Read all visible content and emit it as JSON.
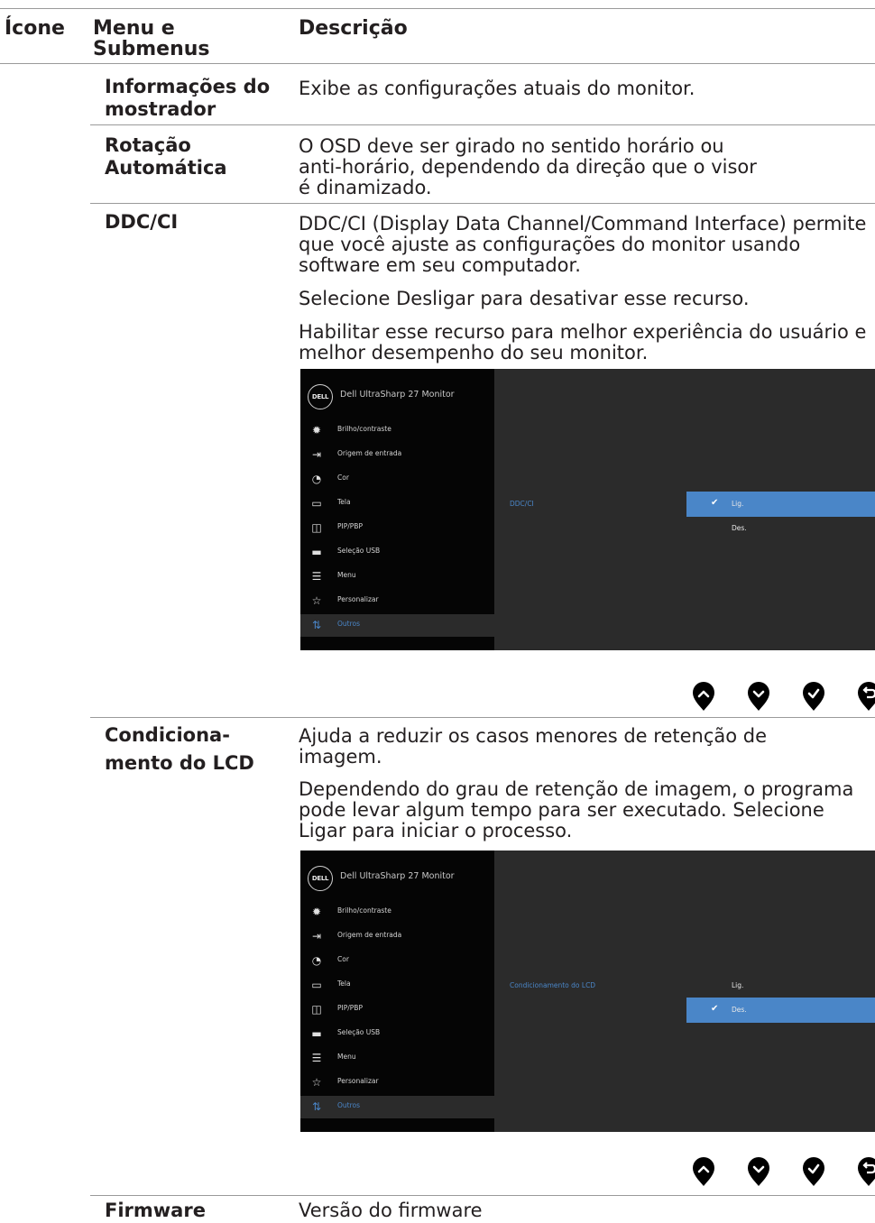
{
  "header": {
    "icon": "Ícone",
    "menu": "Menu e Submenus",
    "description": "Descrição"
  },
  "rows": {
    "info": {
      "menu": "Informações do mostrador",
      "desc": "Exibe as configurações atuais do monitor."
    },
    "rot": {
      "menu": "Rotação Automática",
      "desc": "O OSD deve ser girado no sentido horário ou anti-horário, dependendo da direção que o visor é dinamizado."
    },
    "ddc": {
      "menu": "DDC/CI",
      "desc1": "DDC/CI (Display Data Channel/Command Interface) permite que você ajuste as configurações do monitor usando software em seu computador.",
      "desc2": "Selecione Desligar para desativar esse recurso.",
      "desc3": "Habilitar esse recurso para melhor experiência do usuário e melhor desempenho do seu monitor."
    },
    "lcd": {
      "menu": "Condiciona-mento do LCD",
      "desc1": "Ajuda a reduzir os casos menores de retenção de imagem.",
      "desc2": "Dependendo do grau de retenção de imagem, o programa pode levar algum tempo para ser executado. Selecione Ligar para iniciar o processo."
    },
    "fw": {
      "menu": "Firmware",
      "desc": "Versão do firmware"
    }
  },
  "osd": {
    "logo": "DELL",
    "model": "Dell UltraSharp 27 Monitor",
    "menu": [
      "Brilho/contraste",
      "Origem de entrada",
      "Cor",
      "Tela",
      "PIP/PBP",
      "Seleção USB",
      "Menu",
      "Personalizar",
      "Outros"
    ],
    "icons": [
      "brightness-icon",
      "input-source-icon",
      "color-icon",
      "display-icon",
      "pip-pbp-icon",
      "usb-icon",
      "menu-icon",
      "star-icon",
      "others-icon"
    ],
    "selected_item": "Outros",
    "ddc": {
      "option": "DDC/CI",
      "values": [
        "Lig.",
        "Des."
      ],
      "selected": "Lig."
    },
    "lcd": {
      "option": "Condicionamento do LCD",
      "values": [
        "Lig.",
        "Des."
      ],
      "selected": "Des."
    },
    "accent": "#4a86c8"
  },
  "nav_buttons": [
    "up-button",
    "down-button",
    "ok-button",
    "back-button"
  ]
}
